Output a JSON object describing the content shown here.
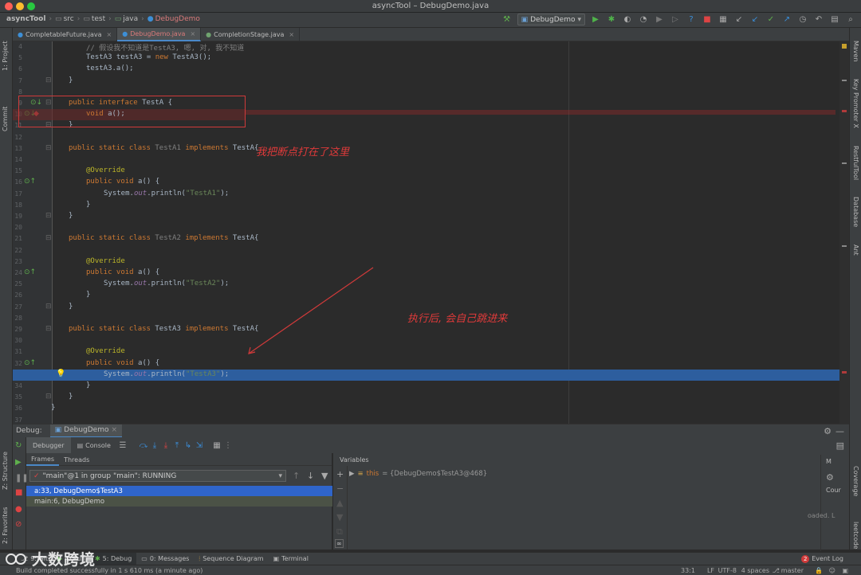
{
  "window": {
    "title": "asyncTool – DebugDemo.java",
    "lights": [
      "#fe5f57",
      "#febc2e",
      "#28c840"
    ]
  },
  "breadcrumb": [
    "asyncTool",
    "src",
    "test",
    "java",
    "DebugDemo"
  ],
  "run_config": "DebugDemo",
  "left_strip": [
    "1: Project",
    "Commit",
    "Z: Structure",
    "2: Favorites"
  ],
  "right_strip": [
    "Maven",
    "Key Promoter X",
    "RestfulTool",
    "Database",
    "Ant",
    "Coverage",
    "leetcode"
  ],
  "editor_tabs": [
    {
      "label": "CompletableFuture.java",
      "active": false
    },
    {
      "label": "DebugDemo.java",
      "active": true
    },
    {
      "label": "CompletionStage.java",
      "active": false
    }
  ],
  "code_lines": [
    {
      "n": "4",
      "indent": 2,
      "segs": [
        {
          "t": "// 假设我不知道是TestA3, 嗯, 对, 我不知道",
          "c": "cmt"
        }
      ]
    },
    {
      "n": "5",
      "indent": 2,
      "segs": [
        {
          "t": "TestA3 testA3 = ",
          "c": ""
        },
        {
          "t": "new ",
          "c": "kw"
        },
        {
          "t": "TestA3();",
          "c": ""
        }
      ]
    },
    {
      "n": "6",
      "indent": 2,
      "segs": [
        {
          "t": "testA3.a();",
          "c": ""
        }
      ]
    },
    {
      "n": "7",
      "indent": 1,
      "segs": [
        {
          "t": "}",
          "c": ""
        }
      ]
    },
    {
      "n": "8",
      "indent": 0,
      "segs": []
    },
    {
      "n": "9",
      "indent": 1,
      "segs": [
        {
          "t": "public interface ",
          "c": "kw"
        },
        {
          "t": "TestA {",
          "c": ""
        }
      ]
    },
    {
      "n": "10",
      "indent": 2,
      "segs": [
        {
          "t": "void ",
          "c": "kw"
        },
        {
          "t": "a();",
          "c": ""
        }
      ]
    },
    {
      "n": "11",
      "indent": 1,
      "segs": [
        {
          "t": "}",
          "c": ""
        }
      ]
    },
    {
      "n": "12",
      "indent": 0,
      "segs": []
    },
    {
      "n": "13",
      "indent": 1,
      "segs": [
        {
          "t": "public static class ",
          "c": "kw"
        },
        {
          "t": "TestA1 ",
          "c": "cls-gray"
        },
        {
          "t": "implements ",
          "c": "kw"
        },
        {
          "t": "TestA{",
          "c": ""
        }
      ]
    },
    {
      "n": "14",
      "indent": 0,
      "segs": []
    },
    {
      "n": "15",
      "indent": 2,
      "segs": [
        {
          "t": "@Override",
          "c": "ann"
        }
      ]
    },
    {
      "n": "16",
      "indent": 2,
      "segs": [
        {
          "t": "public void ",
          "c": "kw"
        },
        {
          "t": "a() {",
          "c": ""
        }
      ]
    },
    {
      "n": "17",
      "indent": 3,
      "segs": [
        {
          "t": "System.",
          "c": ""
        },
        {
          "t": "out",
          "c": "fld"
        },
        {
          "t": ".println(",
          "c": ""
        },
        {
          "t": "\"TestA1\"",
          "c": "str"
        },
        {
          "t": ");",
          "c": ""
        }
      ]
    },
    {
      "n": "18",
      "indent": 2,
      "segs": [
        {
          "t": "}",
          "c": ""
        }
      ]
    },
    {
      "n": "19",
      "indent": 1,
      "segs": [
        {
          "t": "}",
          "c": ""
        }
      ]
    },
    {
      "n": "20",
      "indent": 0,
      "segs": []
    },
    {
      "n": "21",
      "indent": 1,
      "segs": [
        {
          "t": "public static class ",
          "c": "kw"
        },
        {
          "t": "TestA2 ",
          "c": "cls-gray"
        },
        {
          "t": "implements ",
          "c": "kw"
        },
        {
          "t": "TestA{",
          "c": ""
        }
      ]
    },
    {
      "n": "22",
      "indent": 0,
      "segs": []
    },
    {
      "n": "23",
      "indent": 2,
      "segs": [
        {
          "t": "@Override",
          "c": "ann"
        }
      ]
    },
    {
      "n": "24",
      "indent": 2,
      "segs": [
        {
          "t": "public void ",
          "c": "kw"
        },
        {
          "t": "a() {",
          "c": ""
        }
      ]
    },
    {
      "n": "25",
      "indent": 3,
      "segs": [
        {
          "t": "System.",
          "c": ""
        },
        {
          "t": "out",
          "c": "fld"
        },
        {
          "t": ".println(",
          "c": ""
        },
        {
          "t": "\"TestA2\"",
          "c": "str"
        },
        {
          "t": ");",
          "c": ""
        }
      ]
    },
    {
      "n": "26",
      "indent": 2,
      "segs": [
        {
          "t": "}",
          "c": ""
        }
      ]
    },
    {
      "n": "27",
      "indent": 1,
      "segs": [
        {
          "t": "}",
          "c": ""
        }
      ]
    },
    {
      "n": "28",
      "indent": 0,
      "segs": []
    },
    {
      "n": "29",
      "indent": 1,
      "segs": [
        {
          "t": "public static class ",
          "c": "kw"
        },
        {
          "t": "TestA3 ",
          "c": ""
        },
        {
          "t": "implements ",
          "c": "kw"
        },
        {
          "t": "TestA{",
          "c": ""
        }
      ]
    },
    {
      "n": "30",
      "indent": 0,
      "segs": []
    },
    {
      "n": "31",
      "indent": 2,
      "segs": [
        {
          "t": "@Override",
          "c": "ann"
        }
      ]
    },
    {
      "n": "32",
      "indent": 2,
      "segs": [
        {
          "t": "public void ",
          "c": "kw"
        },
        {
          "t": "a() {",
          "c": ""
        }
      ]
    },
    {
      "n": "33",
      "indent": 3,
      "segs": [
        {
          "t": "System.",
          "c": ""
        },
        {
          "t": "out",
          "c": "fld"
        },
        {
          "t": ".println(",
          "c": ""
        },
        {
          "t": "\"TestA3\"",
          "c": "str"
        },
        {
          "t": ");",
          "c": ""
        }
      ]
    },
    {
      "n": "34",
      "indent": 2,
      "segs": [
        {
          "t": "}",
          "c": ""
        }
      ]
    },
    {
      "n": "35",
      "indent": 1,
      "segs": [
        {
          "t": "}",
          "c": ""
        }
      ]
    },
    {
      "n": "36",
      "indent": 0,
      "segs": [
        {
          "t": "}",
          "c": ""
        }
      ]
    },
    {
      "n": "37",
      "indent": 0,
      "segs": []
    }
  ],
  "annotations": {
    "breakpoint_note": "我把断点打在了这里",
    "jump_note": "执行后, 会自己跳进来"
  },
  "debug": {
    "label": "Debug:",
    "session_tab": "DebugDemo",
    "debugger_tab": "Debugger",
    "console_tab": "Console",
    "frames_tab": "Frames",
    "threads_tab": "Threads",
    "thread_selector": "\"main\"@1 in group \"main\": RUNNING",
    "frames": [
      {
        "label": "a:33, DebugDemo$TestA3",
        "selected": true
      },
      {
        "label": "main:6, DebugDemo",
        "selected": false
      }
    ],
    "variables_title": "Variables",
    "variable": {
      "name": "this",
      "value": "= {DebugDemo$TestA3@468}"
    },
    "right_partial": [
      "Cour",
      "oaded. L"
    ]
  },
  "bottom_tabs": [
    {
      "icon": "git",
      "label": "9: Git"
    },
    {
      "icon": "run",
      "label": "4: Run"
    },
    {
      "icon": "debug",
      "label": "5: Debug"
    },
    {
      "icon": "msg",
      "label": "0: Messages"
    },
    {
      "icon": "seq",
      "label": "Sequence Diagram"
    },
    {
      "icon": "term",
      "label": "Terminal"
    }
  ],
  "event_log": {
    "count": "2",
    "label": "Event Log"
  },
  "status": {
    "message": "Build completed successfully in 1 s 610 ms (a minute ago)",
    "position": "33:1",
    "line_sep": "LF",
    "encoding": "UTF-8",
    "indent": "4 spaces",
    "branch": "master"
  },
  "watermark": "大数跨境"
}
